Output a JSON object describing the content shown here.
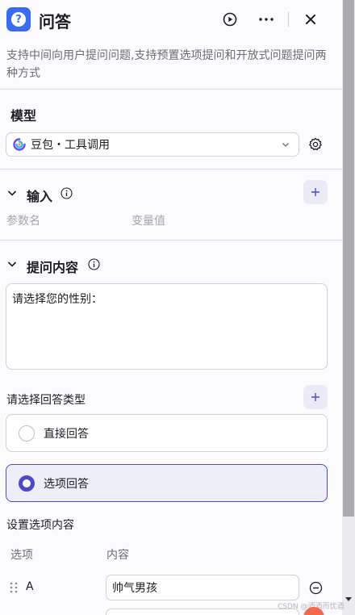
{
  "header": {
    "title": "问答",
    "logo_icon": "question-icon",
    "run_icon": "play-circle-icon",
    "more_icon": "more-dots-icon",
    "close_icon": "close-icon",
    "accent_color": "#3b6cf0"
  },
  "description": "支持中间向用户提问问题,支持预置选项提问和开放式问题提问两种方式",
  "model": {
    "section_title": "模型",
    "selected": "豆包・工具调用",
    "settings_icon": "gear-icon"
  },
  "input": {
    "section_title": "输入",
    "columns": [
      "参数名",
      "变量值"
    ]
  },
  "question": {
    "section_title": "提问内容",
    "content": "请选择您的性别："
  },
  "answer_type": {
    "label": "请选择回答类型",
    "options": [
      {
        "label": "直接回答",
        "checked": false
      },
      {
        "label": "选项回答",
        "checked": true
      }
    ],
    "selected_color": "#4d49c8"
  },
  "options_setting": {
    "label": "设置选项内容",
    "columns": [
      "选项",
      "内容"
    ],
    "rows": [
      {
        "key": "A",
        "value": "帅气男孩"
      }
    ]
  },
  "watermark": "CSDN @酒酒而忧酒"
}
